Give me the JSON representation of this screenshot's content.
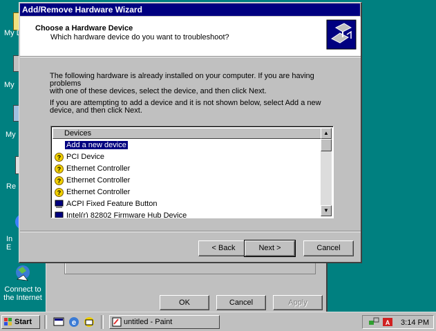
{
  "desktop": {
    "icons": [
      {
        "label": "My D",
        "icon": "my-documents-icon"
      },
      {
        "label": "My",
        "icon": "my-computer-icon"
      },
      {
        "label": "My",
        "icon": "network-neighborhood-icon"
      },
      {
        "label": "Re",
        "icon": "recycle-bin-icon"
      },
      {
        "label": "In E",
        "icon": "internet-explorer-icon"
      },
      {
        "label": "Connect to the Internet",
        "icon": "connect-to-internet-icon"
      }
    ]
  },
  "background_dialog": {
    "ok_label": "OK",
    "cancel_label": "Cancel",
    "apply_label": "Apply"
  },
  "wizard": {
    "title": "Add/Remove Hardware Wizard",
    "header_title": "Choose a Hardware Device",
    "header_subtitle": "Which hardware device do you want to troubleshoot?",
    "intro_line1": "The following hardware is already installed on your computer. If you are having problems",
    "intro_line2": "with one of these devices, select the device, and then click Next.",
    "intro2_line1": "If you are attempting to add a device and it is not shown below, select Add a new",
    "intro2_line2": "device, and then click Next.",
    "list_header": "Devices",
    "devices": [
      {
        "label": "Add a new device",
        "icon": "none",
        "selected": true
      },
      {
        "label": "PCI Device",
        "icon": "unknown-device-icon",
        "selected": false
      },
      {
        "label": "Ethernet Controller",
        "icon": "unknown-device-icon",
        "selected": false
      },
      {
        "label": "Ethernet Controller",
        "icon": "unknown-device-icon",
        "selected": false
      },
      {
        "label": "Ethernet Controller",
        "icon": "unknown-device-icon",
        "selected": false
      },
      {
        "label": "ACPI Fixed Feature Button",
        "icon": "system-device-icon",
        "selected": false
      },
      {
        "label": "Intel(r) 82802 Firmware Hub Device",
        "icon": "system-device-icon",
        "selected": false
      }
    ],
    "back_label": "< Back",
    "next_label": "Next >",
    "cancel_label": "Cancel"
  },
  "taskbar": {
    "start_label": "Start",
    "task_label": "untitled - Paint",
    "clock": "3:14 PM"
  },
  "colors": {
    "desktop": "#008080",
    "titlebar": "#000080",
    "selection": "#000080",
    "face": "#c0c0c0"
  }
}
